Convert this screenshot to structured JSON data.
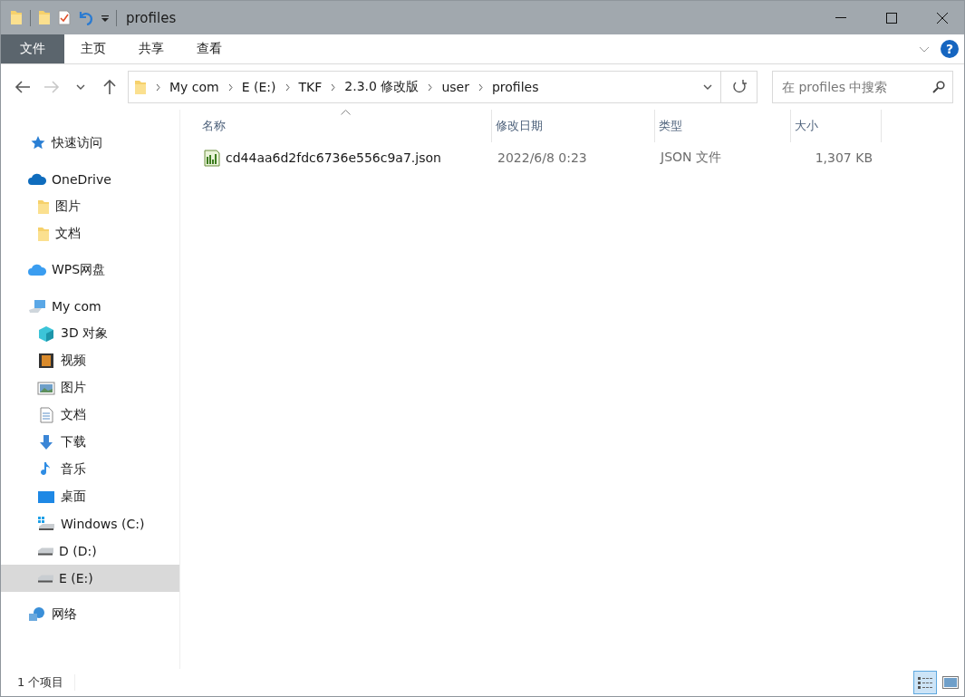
{
  "window": {
    "title": "profiles"
  },
  "ribbon_tabs": [
    {
      "label": "文件",
      "selected": true
    },
    {
      "label": "主页",
      "selected": false
    },
    {
      "label": "共享",
      "selected": false
    },
    {
      "label": "查看",
      "selected": false
    }
  ],
  "nav_buttons": [
    {
      "kind": "back",
      "disabled": false
    },
    {
      "kind": "forward",
      "disabled": true
    },
    {
      "kind": "recent",
      "disabled": false
    },
    {
      "kind": "up",
      "disabled": false
    }
  ],
  "help_button": {
    "label": "?"
  },
  "address": {
    "segments": [
      "My com",
      "E (E:)",
      "TKF",
      "2.3.0 修改版",
      "user",
      "profiles"
    ]
  },
  "search": {
    "placeholder": "在 profiles 中搜索"
  },
  "sidebar": {
    "items": [
      {
        "label": "快速访问",
        "kind": "star",
        "selected": false
      },
      {
        "label": "OneDrive",
        "kind": "cloud",
        "selected": false,
        "children": [
          {
            "label": "图片",
            "kind": "folder",
            "selected": false
          },
          {
            "label": "文档",
            "kind": "folder",
            "selected": false
          }
        ]
      },
      {
        "label": "WPS网盘",
        "kind": "cloud2",
        "selected": false
      },
      {
        "label": "My com",
        "kind": "computer",
        "selected": false,
        "children": [
          {
            "label": "3D 对象",
            "kind": "cube",
            "selected": false
          },
          {
            "label": "视频",
            "kind": "film",
            "selected": false
          },
          {
            "label": "图片",
            "kind": "picture",
            "selected": false
          },
          {
            "label": "文档",
            "kind": "document",
            "selected": false
          },
          {
            "label": "下载",
            "kind": "download",
            "selected": false
          },
          {
            "label": "音乐",
            "kind": "music",
            "selected": false
          },
          {
            "label": "桌面",
            "kind": "desktop",
            "selected": false
          },
          {
            "label": "Windows (C:)",
            "kind": "windrive",
            "selected": false
          },
          {
            "label": "D (D:)",
            "kind": "drive",
            "selected": false
          },
          {
            "label": "E (E:)",
            "kind": "drive",
            "selected": true
          }
        ]
      },
      {
        "label": "网络",
        "kind": "network",
        "selected": false
      }
    ]
  },
  "table": {
    "columns": [
      {
        "label": "名称",
        "sorted": true
      },
      {
        "label": "修改日期",
        "sorted": false
      },
      {
        "label": "类型",
        "sorted": false
      },
      {
        "label": "大小",
        "sorted": false
      }
    ],
    "rows": [
      {
        "name": "cd44aa6d2fdc6736e556c9a7.json",
        "modified": "2022/6/8 0:23",
        "type": "JSON 文件",
        "size": "1,307 KB",
        "selected": false
      }
    ]
  },
  "status_bar": {
    "text": "1 个项目",
    "views": [
      {
        "kind": "details",
        "selected": true
      },
      {
        "kind": "thumbnails",
        "selected": false
      }
    ]
  }
}
